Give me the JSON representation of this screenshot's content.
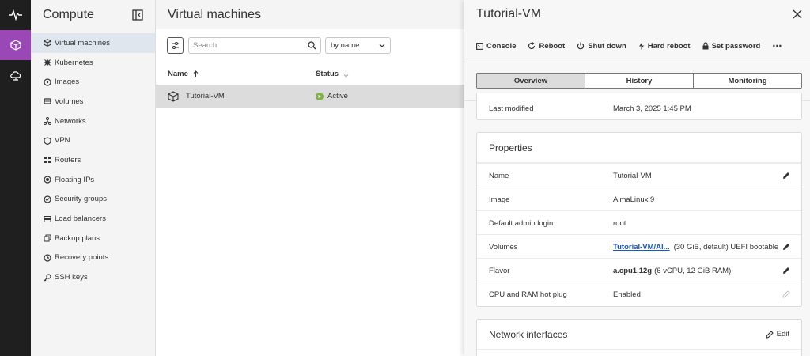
{
  "rail": {
    "items": [
      {
        "icon": "activity-icon",
        "active": false
      },
      {
        "icon": "cube-icon",
        "active": true
      },
      {
        "icon": "cloud-icon",
        "active": false
      }
    ]
  },
  "sidebar": {
    "title": "Compute",
    "items": [
      {
        "label": "Virtual machines",
        "icon": "cube-icon",
        "active": true
      },
      {
        "label": "Kubernetes",
        "icon": "kubernetes-icon"
      },
      {
        "label": "Images",
        "icon": "image-disc-icon"
      },
      {
        "label": "Volumes",
        "icon": "volume-icon"
      },
      {
        "label": "Networks",
        "icon": "network-icon"
      },
      {
        "label": "VPN",
        "icon": "shield-icon"
      },
      {
        "label": "Routers",
        "icon": "router-icon"
      },
      {
        "label": "Floating IPs",
        "icon": "floating-ip-icon"
      },
      {
        "label": "Security groups",
        "icon": "security-group-icon"
      },
      {
        "label": "Load balancers",
        "icon": "load-balancer-icon"
      },
      {
        "label": "Backup plans",
        "icon": "backup-icon"
      },
      {
        "label": "Recovery points",
        "icon": "recovery-icon"
      },
      {
        "label": "SSH keys",
        "icon": "key-icon"
      }
    ]
  },
  "main": {
    "title": "Virtual machines",
    "search_placeholder": "Search",
    "sort_value": "by name",
    "columns": {
      "name": "Name",
      "status": "Status"
    },
    "rows": [
      {
        "name": "Tutorial-VM",
        "status": "Active",
        "status_color": "#7cb342"
      }
    ]
  },
  "panel": {
    "title": "Tutorial-VM",
    "actions": [
      {
        "label": "Console",
        "icon": "console-icon"
      },
      {
        "label": "Reboot",
        "icon": "reboot-icon"
      },
      {
        "label": "Shut down",
        "icon": "power-icon"
      },
      {
        "label": "Hard reboot",
        "icon": "bolt-icon"
      },
      {
        "label": "Set password",
        "icon": "lock-icon"
      }
    ],
    "more_label": "⋯",
    "tabs": [
      {
        "label": "Overview",
        "active": true
      },
      {
        "label": "History",
        "active": false
      },
      {
        "label": "Monitoring",
        "active": false
      }
    ],
    "last_modified": {
      "key": "Last modified",
      "value": "March 3, 2025 1:45 PM"
    },
    "properties": {
      "title": "Properties",
      "name": {
        "key": "Name",
        "value": "Tutorial-VM"
      },
      "image": {
        "key": "Image",
        "value": "AlmaLinux 9"
      },
      "admin": {
        "key": "Default admin login",
        "value": "root"
      },
      "volumes": {
        "key": "Volumes",
        "link": "Tutorial-VM/Al...",
        "rest": "(30 GiB, default) UEFI bootable"
      },
      "flavor": {
        "key": "Flavor",
        "name": "a.cpu1.12g",
        "rest": "(6 vCPU, 12 GiB RAM)"
      },
      "hotplug": {
        "key": "CPU and RAM hot plug",
        "value": "Enabled"
      }
    },
    "network": {
      "title": "Network interfaces",
      "edit_label": "Edit"
    }
  },
  "colors": {
    "accent": "#9a48b5",
    "selected_row": "#dcdcdc",
    "active_sidebar": "#dfe6ee",
    "link": "#1a56c4",
    "status_active": "#7cb342"
  }
}
